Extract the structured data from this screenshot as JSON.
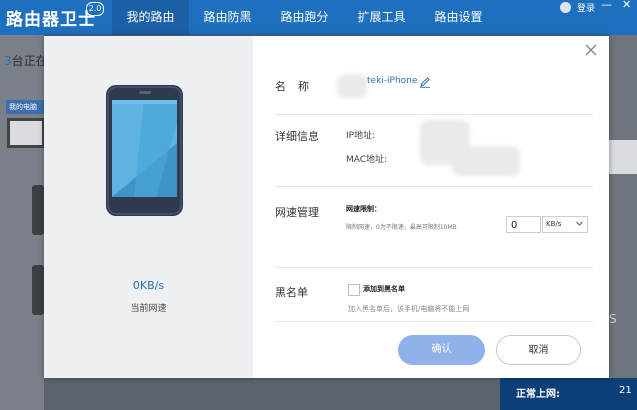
{
  "app": {
    "title": "路由器卫士",
    "version": "2.0"
  },
  "nav": {
    "tabs": [
      "我的路由",
      "路由防黑",
      "路由跑分",
      "扩展工具",
      "路由设置"
    ],
    "active_index": 0
  },
  "titlebar": {
    "login_label": "登录",
    "minimize_glyph": "—",
    "close_glyph": "✕"
  },
  "background": {
    "device_count_num": "3",
    "device_count_text": "台正在",
    "my_pc_label": "我的电脑",
    "right_letter": "S",
    "status_left": "正常上网:",
    "status_right": "21"
  },
  "dialog": {
    "current_speed": "0KB/s",
    "current_speed_caption": "当前网速",
    "name_label": "名称",
    "device_name": "teki-iPhone",
    "detail_label": "详细信息",
    "ip_label": "IP地址:",
    "mac_label": "MAC地址:",
    "speed_mgmt_label": "网速管理",
    "limit_title": "网速限制：",
    "limit_desc": "限制网速，0为不限速，最高可限制10MB",
    "limit_value": "0",
    "limit_unit": "KB/s",
    "blacklist_label": "黑名单",
    "blacklist_checkbox_label": "添加到黑名单",
    "blacklist_checked": false,
    "blacklist_desc": "加入黑名单后，该手机/电脑将不能上网",
    "ok_label": "确认",
    "cancel_label": "取消"
  },
  "icons": [
    "close-icon",
    "edit-icon",
    "phone-icon",
    "chevron-down-icon",
    "avatar-icon"
  ],
  "colors": {
    "topbar": "#1f6fbf",
    "tab_active": "#1b5fa6",
    "accent": "#2e6db3",
    "ok_button": "#8fb2ea",
    "status_bar": "#0d3f78"
  }
}
